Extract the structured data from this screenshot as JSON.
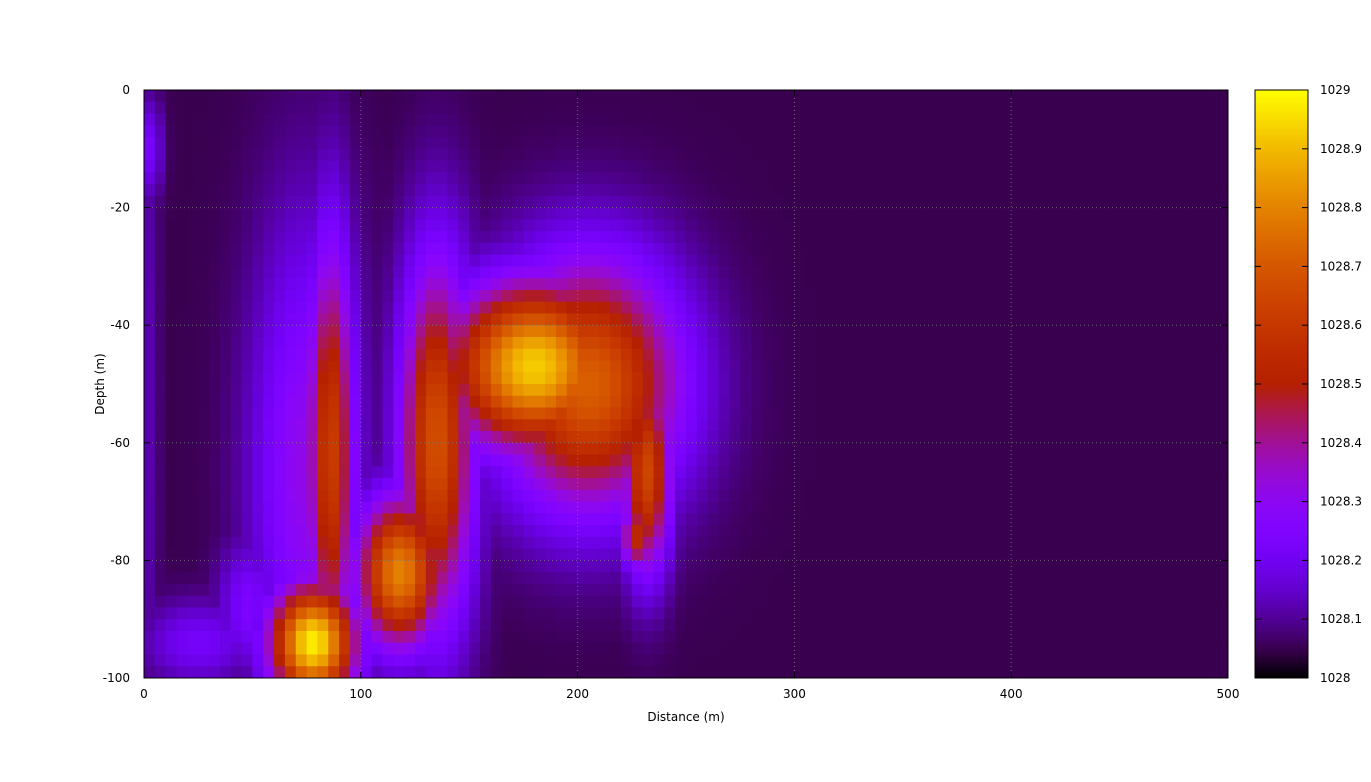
{
  "chart_data": {
    "type": "heatmap",
    "title": "",
    "xlabel": "Distance (m)",
    "ylabel": "Depth (m)",
    "xlim": [
      0,
      500
    ],
    "ylim": [
      -100,
      0
    ],
    "x_ticks": [
      "0",
      "100",
      "200",
      "300",
      "400",
      "500"
    ],
    "y_ticks": [
      "0",
      "-20",
      "-40",
      "-60",
      "-80",
      "-100"
    ],
    "grid": true,
    "colorbar": {
      "range": [
        1028,
        1029
      ],
      "palette": "gnuplot",
      "ticks": [
        "1029",
        "1028.9",
        "1028.8",
        "1028.7",
        "1028.6",
        "1028.5",
        "1028.4",
        "1028.3",
        "1028.2",
        "1028.1",
        "1028"
      ]
    },
    "background_value": 1028.05,
    "features": [
      {
        "name": "left-edge-band",
        "x": 3,
        "depth": 50,
        "sx": 3,
        "sd": 60,
        "value": 1028.12
      },
      {
        "name": "left-edge-top",
        "x": 3,
        "depth": 10,
        "sx": 4,
        "sd": 6,
        "value": 1028.22
      },
      {
        "name": "bottom-left-patch",
        "x": 25,
        "depth": 94,
        "sx": 18,
        "sd": 5,
        "value": 1028.22
      },
      {
        "name": "bottom-left-patch-2",
        "x": 48,
        "depth": 88,
        "sx": 10,
        "sd": 8,
        "value": 1028.24
      },
      {
        "name": "first-lobe-outer",
        "x": 75,
        "depth": 65,
        "sx": 18,
        "sd": 30,
        "value": 1028.32
      },
      {
        "name": "first-lobe-core",
        "x": 86,
        "depth": 62,
        "sx": 8,
        "sd": 26,
        "value": 1028.62
      },
      {
        "name": "bottom-bright-core",
        "x": 78,
        "depth": 94,
        "sx": 14,
        "sd": 7,
        "value": 1028.98
      },
      {
        "name": "second-lobe",
        "x": 135,
        "depth": 60,
        "sx": 12,
        "sd": 22,
        "value": 1028.68
      },
      {
        "name": "main-bright-core",
        "x": 180,
        "depth": 47,
        "sx": 28,
        "sd": 10,
        "value": 1028.93
      },
      {
        "name": "main-plume",
        "x": 205,
        "depth": 50,
        "sx": 30,
        "sd": 15,
        "value": 1028.72
      },
      {
        "name": "right-hook",
        "x": 232,
        "depth": 65,
        "sx": 8,
        "sd": 12,
        "value": 1028.65
      },
      {
        "name": "right-hook-tip",
        "x": 228,
        "depth": 76,
        "sx": 6,
        "sd": 4,
        "value": 1028.55
      },
      {
        "name": "lower-diagonal-bright",
        "x": 118,
        "depth": 82,
        "sx": 14,
        "sd": 9,
        "value": 1028.8
      }
    ]
  }
}
